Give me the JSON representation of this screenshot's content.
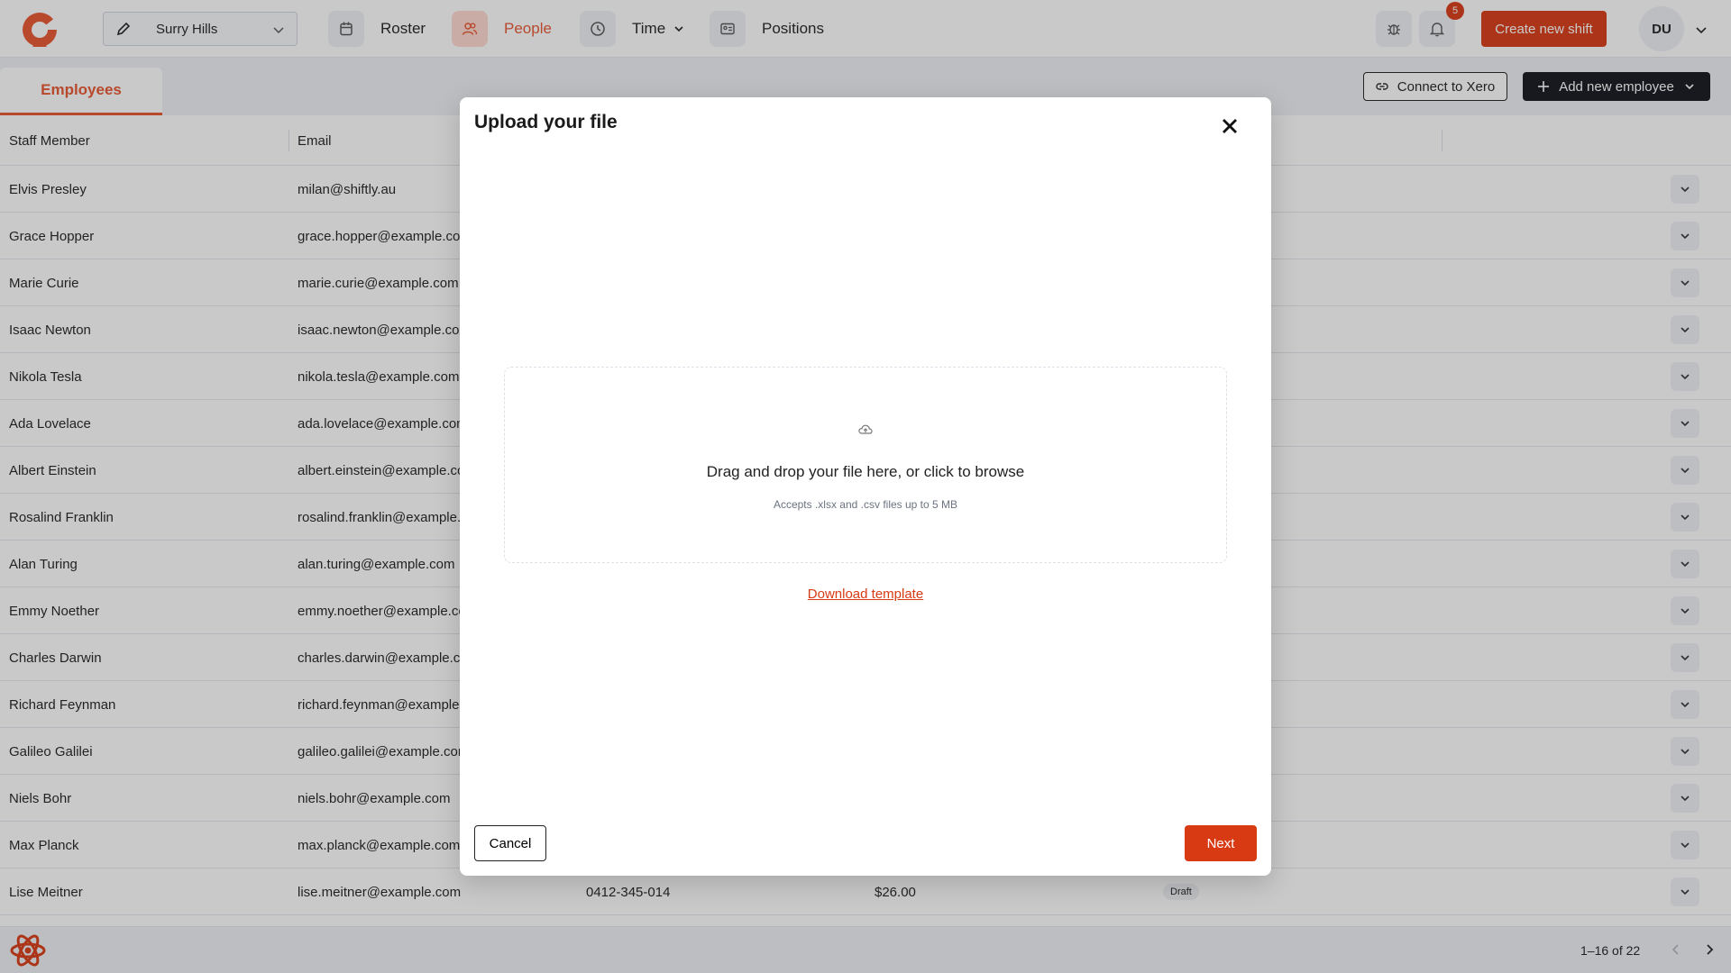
{
  "colors": {
    "accent": "#d83a14",
    "accent_light": "#ffd9cf",
    "dark_button": "#12151c"
  },
  "topbar": {
    "location": "Surry Hills",
    "nav": [
      {
        "label": "Roster",
        "icon": "calendar-icon"
      },
      {
        "label": "People",
        "icon": "users-icon",
        "active": true
      },
      {
        "label": "Time",
        "icon": "clock-icon"
      },
      {
        "label": "Positions",
        "icon": "id-card-icon"
      }
    ],
    "notification_count": "5",
    "create_shift_label": "Create new shift",
    "avatar_initials": "DU"
  },
  "subheader": {
    "tab_employees": "Employees",
    "connect_xero": "Connect to Xero",
    "add_employee": "Add new employee"
  },
  "table": {
    "columns": [
      "Staff Member",
      "Email"
    ],
    "rows": [
      {
        "name": "Elvis Presley",
        "email": "milan@shiftly.au"
      },
      {
        "name": "Grace Hopper",
        "email": "grace.hopper@example.com"
      },
      {
        "name": "Marie Curie",
        "email": "marie.curie@example.com"
      },
      {
        "name": "Isaac Newton",
        "email": "isaac.newton@example.com"
      },
      {
        "name": "Nikola Tesla",
        "email": "nikola.tesla@example.com"
      },
      {
        "name": "Ada Lovelace",
        "email": "ada.lovelace@example.com"
      },
      {
        "name": "Albert Einstein",
        "email": "albert.einstein@example.com"
      },
      {
        "name": "Rosalind Franklin",
        "email": "rosalind.franklin@example.com"
      },
      {
        "name": "Alan Turing",
        "email": "alan.turing@example.com"
      },
      {
        "name": "Emmy Noether",
        "email": "emmy.noether@example.com"
      },
      {
        "name": "Charles Darwin",
        "email": "charles.darwin@example.com"
      },
      {
        "name": "Richard Feynman",
        "email": "richard.feynman@example.com"
      },
      {
        "name": "Galileo Galilei",
        "email": "galileo.galilei@example.com"
      },
      {
        "name": "Niels Bohr",
        "email": "niels.bohr@example.com"
      },
      {
        "name": "Max Planck",
        "email": "max.planck@example.com"
      },
      {
        "name": "Lise Meitner",
        "email": "lise.meitner@example.com",
        "phone": "0412-345-014",
        "rate": "$26.00",
        "status": "Draft"
      }
    ]
  },
  "footer": {
    "pager": "1–16 of 22"
  },
  "modal": {
    "title": "Upload your file",
    "dropzone_main": "Drag and drop your file here, or click to browse",
    "dropzone_sub": "Accepts .xlsx and .csv files up to 5 MB",
    "download_template": "Download template",
    "cancel": "Cancel",
    "next": "Next"
  }
}
